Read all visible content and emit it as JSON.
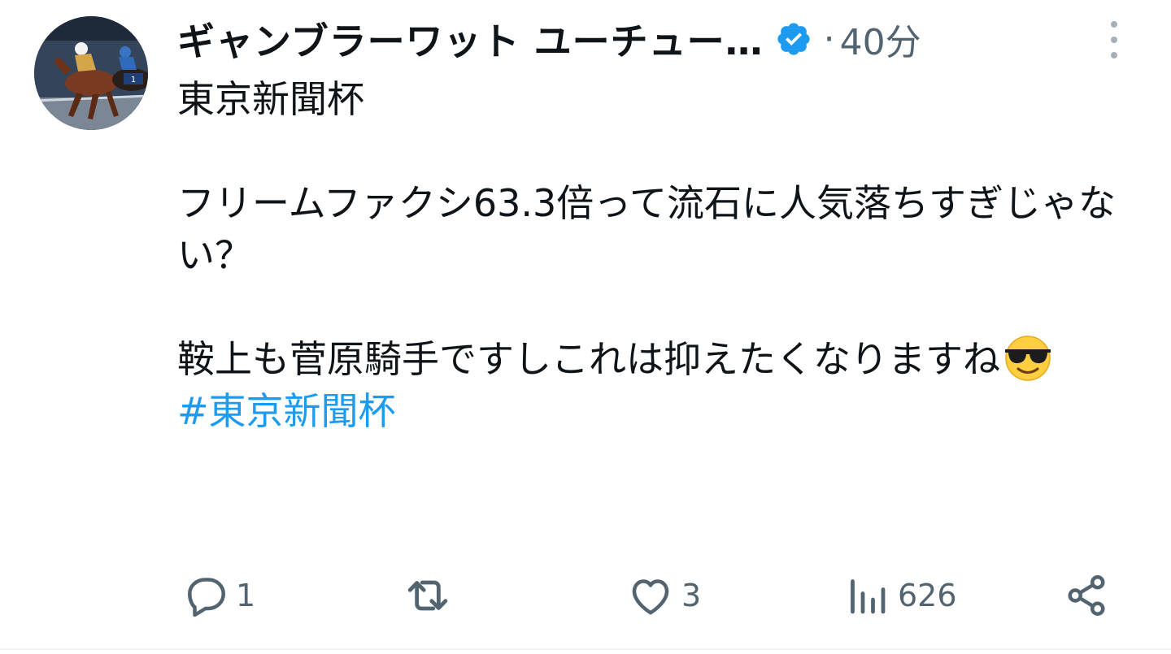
{
  "author": {
    "display_name": "ギャンブラーワット ユーチュー…",
    "verified": true,
    "avatar_icon": "horse-racing-photo"
  },
  "meta": {
    "separator": "·",
    "time": "40分"
  },
  "tweet": {
    "line1": "東京新聞杯",
    "line2": "フリームファクシ63.3倍って流石に人気落ちすぎじゃない？",
    "line3": "鞍上も菅原騎手ですしこれは抑えたくなりますね",
    "emoji": "smiling-face-with-sunglasses",
    "hashtag": "#東京新聞杯"
  },
  "actions": {
    "reply_count": "1",
    "retweet_count": "",
    "like_count": "3",
    "view_count": "626"
  },
  "colors": {
    "accent": "#1d9bf0",
    "secondary_text": "#536471",
    "primary_text": "#0f1419"
  }
}
